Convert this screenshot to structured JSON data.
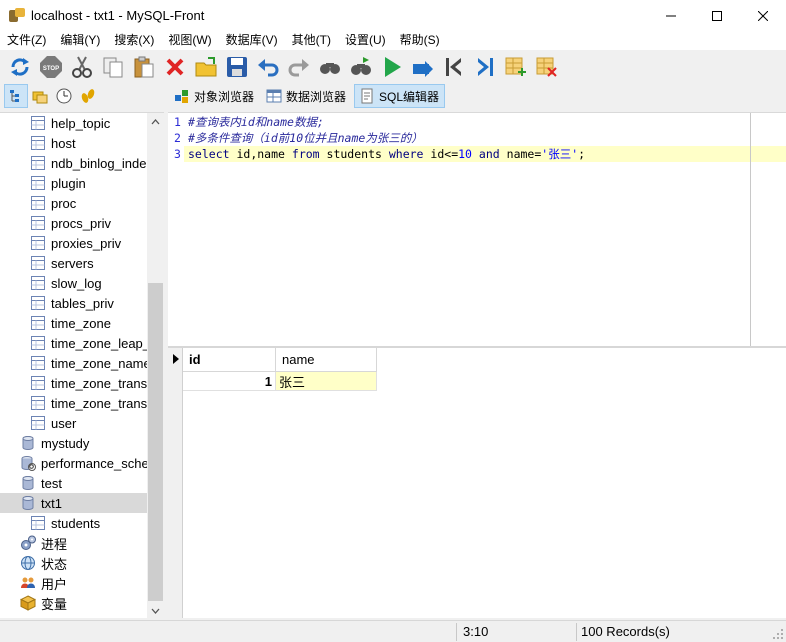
{
  "window": {
    "title": "localhost - txt1 - MySQL-Front"
  },
  "menu": [
    "文件(Z)",
    "编辑(Y)",
    "搜索(X)",
    "视图(W)",
    "数据库(V)",
    "其他(T)",
    "设置(U)",
    "帮助(S)"
  ],
  "toolbar": {
    "buttons": [
      "refresh-icon",
      "stop-icon",
      "cut-icon",
      "copy-icon",
      "paste-icon",
      "delete-icon",
      "open-icon",
      "save-icon",
      "undo-icon",
      "redo-icon",
      "find-icon",
      "replace-icon",
      "run-icon",
      "run-selection-icon",
      "first-icon",
      "last-icon",
      "insert-record-icon",
      "delete-record-icon"
    ]
  },
  "tabs": [
    {
      "label": "对象浏览器",
      "icon": "object-browser-icon",
      "active": false
    },
    {
      "label": "数据浏览器",
      "icon": "data-browser-icon",
      "active": false
    },
    {
      "label": "SQL编辑器",
      "icon": "sql-editor-icon",
      "active": true
    }
  ],
  "sidebar": {
    "tables": [
      "help_topic",
      "host",
      "ndb_binlog_inde",
      "plugin",
      "proc",
      "procs_priv",
      "proxies_priv",
      "servers",
      "slow_log",
      "tables_priv",
      "time_zone",
      "time_zone_leap_s",
      "time_zone_name",
      "time_zone_transi",
      "time_zone_transi",
      "user"
    ],
    "databases": [
      "mystudy",
      "performance_sche",
      "test",
      "txt1"
    ],
    "txt1_tables": [
      "students"
    ],
    "extras": [
      {
        "label": "进程",
        "icon": "process-icon"
      },
      {
        "label": "状态",
        "icon": "status-icon"
      },
      {
        "label": "用户",
        "icon": "users-icon"
      },
      {
        "label": "变量",
        "icon": "variables-icon"
      }
    ]
  },
  "editor": {
    "line_numbers": [
      "1",
      "2",
      "3"
    ],
    "lines": [
      "#查询表内id和name数据;",
      "#多条件查询（id前10位并且name为张三的）"
    ],
    "sql": {
      "kw_select": "select",
      "cols": "id,name",
      "kw_from": "from",
      "table": "students",
      "kw_where": "where",
      "cond1": "id<=",
      "num": "10",
      "kw_and": "and",
      "cond2": "name=",
      "str": "'张三'",
      "end": ";"
    }
  },
  "grid": {
    "columns": [
      "id",
      "name"
    ],
    "rows": [
      {
        "id": "1",
        "name": "张三"
      }
    ]
  },
  "status": {
    "position": "3:10",
    "records": "100 Records(s)"
  },
  "colors": {
    "accent": "#cce4f7",
    "highlight_row": "#ffffc8",
    "selected_tree": "#d9d9d9"
  }
}
